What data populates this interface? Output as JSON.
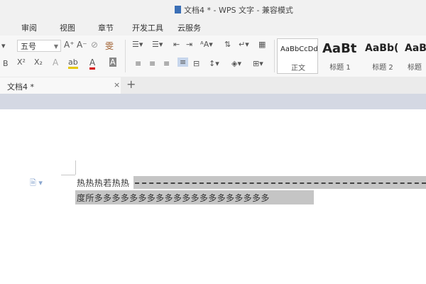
{
  "window": {
    "title": "文档4 * - WPS 文字 - 兼容模式"
  },
  "menu": {
    "items": [
      "审阅",
      "视图",
      "章节",
      "开发工具",
      "云服务"
    ]
  },
  "toolbar": {
    "font_size": "五号",
    "grow_font": "A⁺",
    "shrink_font": "A⁻",
    "clear_format": "⊘",
    "phonetic": "雯",
    "superscript": "X²",
    "subscript": "X₂",
    "text_effect": "A",
    "highlight": "ab",
    "font_color": "A",
    "char_shading": "A",
    "bold_partial": "B"
  },
  "styles": [
    {
      "preview": "AaBbCcDd",
      "name": "正文"
    },
    {
      "preview": "AaBt",
      "name": "标题 1"
    },
    {
      "preview": "AaBb(",
      "name": "标题 2"
    },
    {
      "preview": "AaBl",
      "name": "标题"
    }
  ],
  "tabs": {
    "doc_tab": "文档4 *",
    "close": "×",
    "add": "+"
  },
  "document": {
    "line1": "热热热若热热",
    "line2": "度所多多多多多多多多多多多多多多多多多多多多"
  },
  "colors": {
    "highlight": "#e6c700",
    "font_color": "#d40000",
    "selection": "#c5c5c5",
    "doc_icon": "#3b6fb6"
  }
}
